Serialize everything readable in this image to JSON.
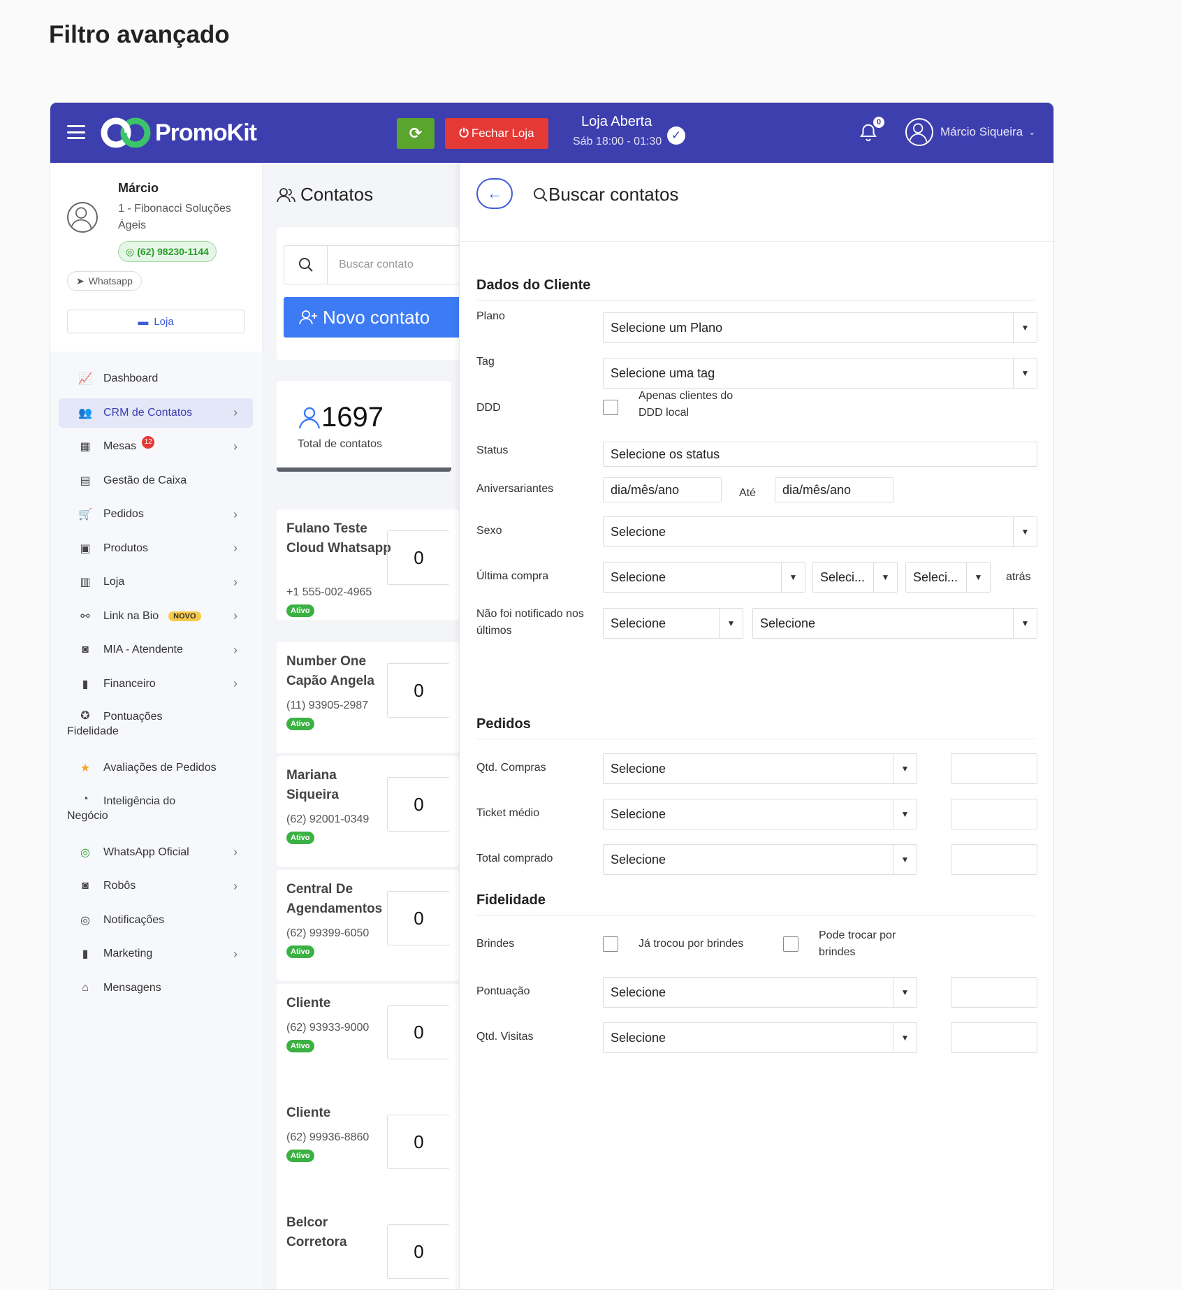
{
  "page": {
    "title": "Filtro avançado"
  },
  "topbar": {
    "brand": "PromoKit",
    "close_store": "Fechar Loja",
    "store_status": "Loja Aberta",
    "store_hours": "Sáb 18:00 - 01:30",
    "notifications": "0",
    "user": "Márcio Siqueira",
    "colors": {
      "bar": "#3d3faf",
      "refresh": "#5aa52d",
      "close": "#e53935"
    }
  },
  "profile": {
    "name": "Márcio",
    "company": "1 - Fibonacci Soluções Ágeis",
    "phone": "(62) 98230-1144",
    "channel": "Whatsapp",
    "store_button": "Loja"
  },
  "nav": [
    {
      "label": "Dashboard",
      "icon": "chart-line-icon"
    },
    {
      "label": "CRM de Contatos",
      "icon": "users-icon",
      "active": true
    },
    {
      "label": "Mesas",
      "icon": "table-icon",
      "badge": "12"
    },
    {
      "label": "Gestão de Caixa",
      "icon": "cash-register-icon"
    },
    {
      "label": "Pedidos",
      "icon": "cart-icon"
    },
    {
      "label": "Produtos",
      "icon": "box-icon"
    },
    {
      "label": "Loja",
      "icon": "building-icon"
    },
    {
      "label": "Link na Bio",
      "icon": "sitemap-icon",
      "badge": "NOVO"
    },
    {
      "label": "MIA - Atendente",
      "icon": "robot-icon"
    },
    {
      "label": "Financeiro",
      "icon": "bar-chart-icon"
    },
    {
      "label": "Pontuações",
      "label2": "Fidelidade",
      "icon": "medal-icon"
    },
    {
      "label": "Avaliações de Pedidos",
      "icon": "star-icon"
    },
    {
      "label": "Inteligência do",
      "label2": "Negócio",
      "icon": "pie-chart-icon"
    },
    {
      "label": "WhatsApp Oficial",
      "icon": "whatsapp-icon"
    },
    {
      "label": "Robôs",
      "icon": "robot-icon"
    },
    {
      "label": "Notificações",
      "icon": "whatsapp-icon"
    },
    {
      "label": "Marketing",
      "icon": "bar-chart-icon"
    },
    {
      "label": "Mensagens",
      "icon": "inbox-icon"
    }
  ],
  "contacts": {
    "title": "Contatos",
    "search_placeholder": "Buscar contato",
    "new_button": "Novo contato",
    "total": "1697",
    "total_label": "Total de contatos",
    "list": [
      {
        "name": "Fulano Teste Cloud Whatsapp",
        "phone": "+1 555-002-4965",
        "status": "Ativo",
        "count": "0"
      },
      {
        "name": "Number One Capão Angela",
        "phone": "(11) 93905-2987",
        "status": "Ativo",
        "count": "0"
      },
      {
        "name": "Mariana Siqueira",
        "phone": "(62) 92001-0349",
        "status": "Ativo",
        "count": "0"
      },
      {
        "name": "Central De Agendamentos",
        "phone": "(62) 99399-6050",
        "status": "Ativo",
        "count": "0"
      },
      {
        "name": "Cliente",
        "phone": "(62) 93933-9000",
        "status": "Ativo",
        "count": "0"
      },
      {
        "name": "Cliente",
        "phone": "(62) 99936-8860",
        "status": "Ativo",
        "count": "0"
      },
      {
        "name": "Belcor Corretora",
        "phone": "",
        "status": "",
        "count": "0"
      }
    ]
  },
  "panel": {
    "title": "Buscar contatos",
    "sections": {
      "cliente": "Dados do Cliente",
      "pedidos": "Pedidos",
      "fidelidade": "Fidelidade"
    },
    "labels": {
      "plano": "Plano",
      "tag": "Tag",
      "ddd": "DDD",
      "status": "Status",
      "aniversariantes": "Aniversariantes",
      "sexo": "Sexo",
      "ultima_compra": "Última compra",
      "nao_notificado": "Não foi notificado nos últimos",
      "qtd_compras": "Qtd. Compras",
      "ticket_medio": "Ticket médio",
      "total_comprado": "Total comprado",
      "brindes": "Brindes",
      "pontuacao": "Pontuação",
      "qtd_visitas": "Qtd. Visitas"
    },
    "values": {
      "plano": "Selecione um Plano",
      "tag": "Selecione uma tag",
      "ddd_check": "Apenas clientes do DDD local",
      "status": "Selecione os status",
      "date_from": "dia/mês/ano",
      "ate": "Até",
      "date_to": "dia/mês/ano",
      "sexo": "Selecione",
      "ultima1": "Selecione",
      "ultima2": "Seleci...",
      "ultima3": "Seleci...",
      "atras": "atrás",
      "notif1": "Selecione",
      "notif2": "Selecione",
      "qtd_compras": "Selecione",
      "ticket_medio": "Selecione",
      "total_comprado": "Selecione",
      "brinde1": "Já trocou por brindes",
      "brinde2": "Pode trocar por brindes",
      "pontuacao": "Selecione",
      "qtd_visitas": "Selecione"
    }
  }
}
